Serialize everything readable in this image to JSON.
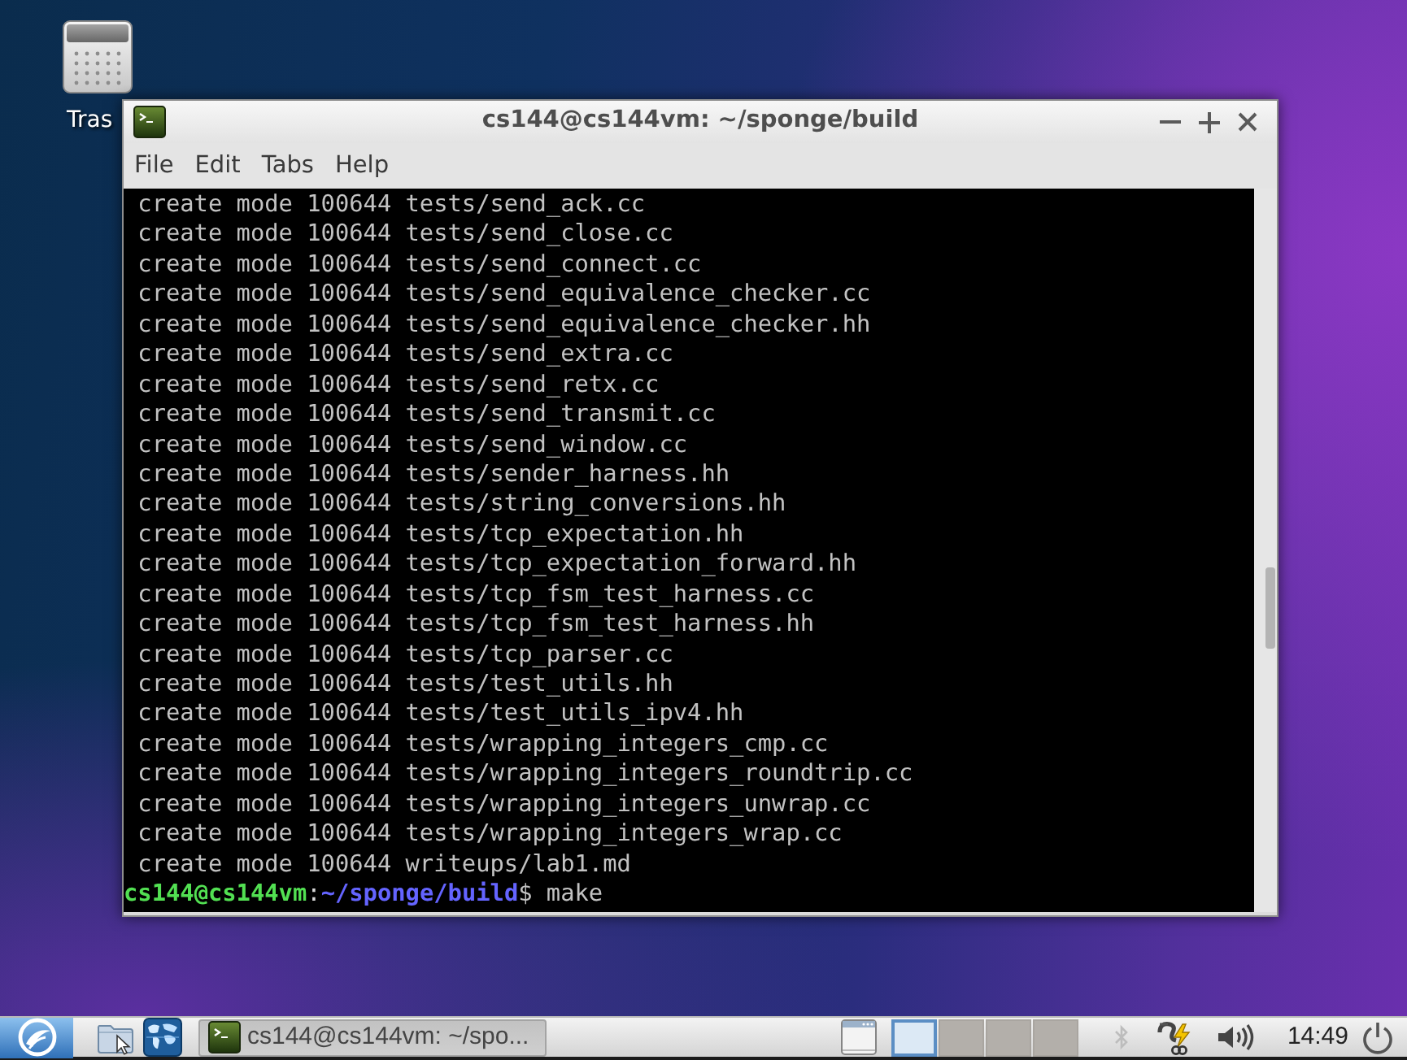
{
  "desktop": {
    "icons": [
      {
        "label": "Tras"
      }
    ]
  },
  "window": {
    "title": "cs144@cs144vm: ~/sponge/build",
    "controls": [
      {
        "kind": "minimize"
      },
      {
        "kind": "maximize"
      },
      {
        "kind": "close"
      }
    ],
    "menu": [
      "File",
      "Edit",
      "Tabs",
      "Help"
    ],
    "terminal": {
      "lines": [
        {
          "kind": "output",
          "text": "create mode 100644 tests/send_ack.cc"
        },
        {
          "kind": "output",
          "text": "create mode 100644 tests/send_close.cc"
        },
        {
          "kind": "output",
          "text": "create mode 100644 tests/send_connect.cc"
        },
        {
          "kind": "output",
          "text": "create mode 100644 tests/send_equivalence_checker.cc"
        },
        {
          "kind": "output",
          "text": "create mode 100644 tests/send_equivalence_checker.hh"
        },
        {
          "kind": "output",
          "text": "create mode 100644 tests/send_extra.cc"
        },
        {
          "kind": "output",
          "text": "create mode 100644 tests/send_retx.cc"
        },
        {
          "kind": "output",
          "text": "create mode 100644 tests/send_transmit.cc"
        },
        {
          "kind": "output",
          "text": "create mode 100644 tests/send_window.cc"
        },
        {
          "kind": "output",
          "text": "create mode 100644 tests/sender_harness.hh"
        },
        {
          "kind": "output",
          "text": "create mode 100644 tests/string_conversions.hh"
        },
        {
          "kind": "output",
          "text": "create mode 100644 tests/tcp_expectation.hh"
        },
        {
          "kind": "output",
          "text": "create mode 100644 tests/tcp_expectation_forward.hh"
        },
        {
          "kind": "output",
          "text": "create mode 100644 tests/tcp_fsm_test_harness.cc"
        },
        {
          "kind": "output",
          "text": "create mode 100644 tests/tcp_fsm_test_harness.hh"
        },
        {
          "kind": "output",
          "text": "create mode 100644 tests/tcp_parser.cc"
        },
        {
          "kind": "output",
          "text": "create mode 100644 tests/test_utils.hh"
        },
        {
          "kind": "output",
          "text": "create mode 100644 tests/test_utils_ipv4.hh"
        },
        {
          "kind": "output",
          "text": "create mode 100644 tests/wrapping_integers_cmp.cc"
        },
        {
          "kind": "output",
          "text": "create mode 100644 tests/wrapping_integers_roundtrip.cc"
        },
        {
          "kind": "output",
          "text": "create mode 100644 tests/wrapping_integers_unwrap.cc"
        },
        {
          "kind": "output",
          "text": "create mode 100644 tests/wrapping_integers_wrap.cc"
        },
        {
          "kind": "output",
          "text": "create mode 100644 writeups/lab1.md"
        },
        {
          "kind": "prompt",
          "user_host": "cs144@cs144vm",
          "separator": ":",
          "path": "~/sponge/build",
          "symbol": "$",
          "command": "make"
        }
      ]
    }
  },
  "taskbar": {
    "tasks": [
      {
        "label": "cs144@cs144vm: ~/spo...",
        "selected": true
      }
    ],
    "pager": [
      {
        "selected": true
      },
      {
        "selected": false
      },
      {
        "selected": false
      },
      {
        "selected": false
      }
    ],
    "clock": "14:49"
  }
}
